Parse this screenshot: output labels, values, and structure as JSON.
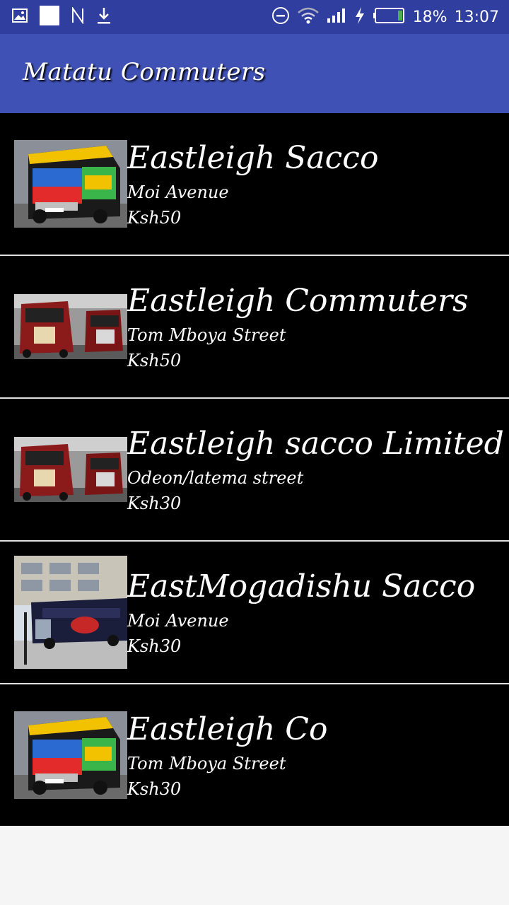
{
  "status_bar": {
    "battery": "18%",
    "time": "13:07",
    "icons": [
      "image-icon",
      "square-icon",
      "n-icon",
      "download-icon",
      "do-not-disturb-icon",
      "wifi-icon",
      "signal-icon",
      "charging-icon",
      "battery-icon"
    ]
  },
  "app_bar": {
    "title": "Matatu Commuters"
  },
  "saccos": [
    {
      "name": "Eastleigh Sacco",
      "route": "Moi Avenue",
      "fare": "Ksh50",
      "image": "colorful-matatu"
    },
    {
      "name": "Eastleigh Commuters",
      "route": "Tom Mboya Street",
      "fare": "Ksh50",
      "image": "red-matatus"
    },
    {
      "name": "Eastleigh sacco Limited",
      "route": "Odeon/latema street",
      "fare": "Ksh30",
      "image": "red-matatus"
    },
    {
      "name": "EastMogadishu Sacco",
      "route": "Moi Avenue",
      "fare": "Ksh30",
      "image": "street-matatu"
    },
    {
      "name": "Eastleigh Co",
      "route": "Tom Mboya Street",
      "fare": "Ksh30",
      "image": "colorful-matatu"
    }
  ]
}
